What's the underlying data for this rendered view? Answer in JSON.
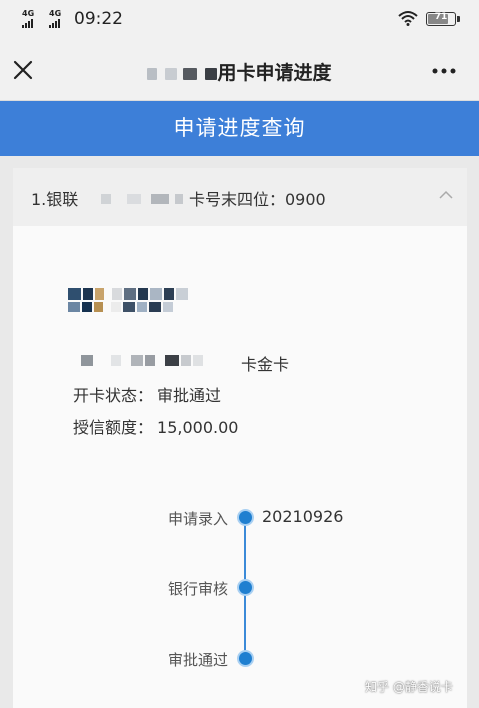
{
  "status_bar": {
    "sim1": "4G",
    "sim2": "4G",
    "time": "09:22",
    "battery": "71",
    "battery_fraction": 0.71,
    "icons": [
      "signal-icon",
      "wifi-icon",
      "battery-icon"
    ]
  },
  "nav": {
    "title": "用卡申请进度",
    "close_icon": "close-icon",
    "more_icon": "more-icon"
  },
  "banner": {
    "title": "申请进度查询"
  },
  "card": {
    "index_label": "1.银联",
    "tail_label": "卡号末四位：0900",
    "product_suffix": "卡金卡",
    "status_label": "开卡状态：",
    "status_value": "审批通过",
    "limit_label": "授信额度：",
    "limit_value": "15,000.00"
  },
  "timeline": [
    {
      "label": "申请录入",
      "date": "20210926"
    },
    {
      "label": "银行审核",
      "date": ""
    },
    {
      "label": "审批通过",
      "date": ""
    }
  ],
  "watermark": "知乎 @静香说卡",
  "colors": {
    "banner": "#3d7fd8",
    "timeline": "#1f7fd0",
    "background": "#e9e9e9"
  }
}
